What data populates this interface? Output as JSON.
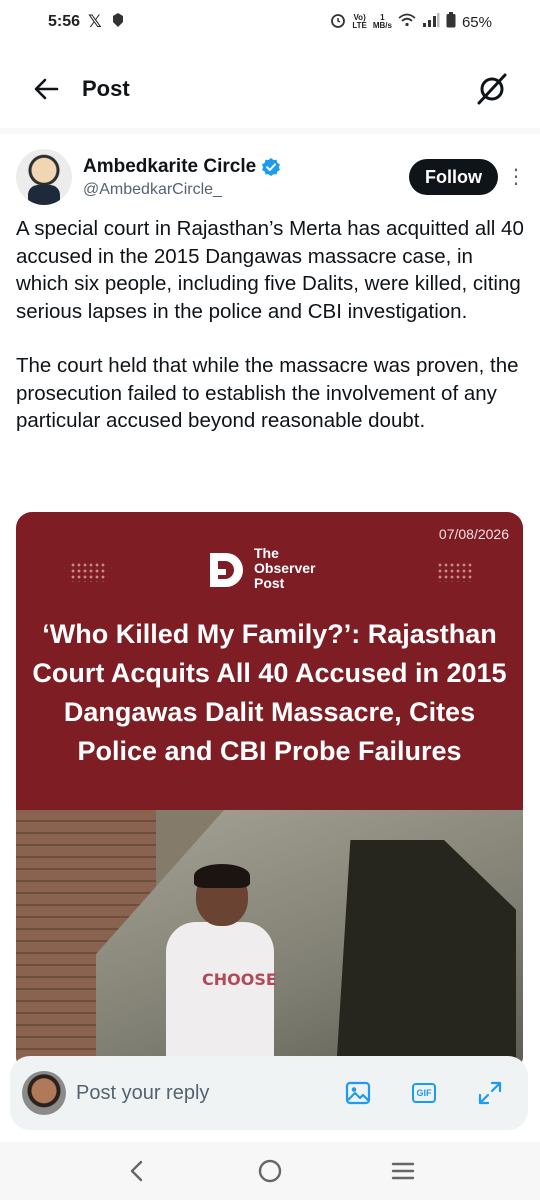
{
  "status_bar": {
    "time": "5:56",
    "net_top": "Vo)",
    "net_bottom": "LTE",
    "speed_top": "1",
    "speed_bottom": "MB/s",
    "battery": "65%"
  },
  "header": {
    "title": "Post"
  },
  "author": {
    "name": "Ambedkarite Circle",
    "handle": "@AmbedkarCircle_",
    "verified": true,
    "follow_label": "Follow",
    "more_glyph": "⋮"
  },
  "tweet": {
    "paragraph_1": "A special court in Rajasthan’s Merta has acquitted all 40 accused in the 2015 Dangawas massacre case, in which six people, including five Dalits, were killed, citing serious lapses in the police and CBI investigation.",
    "paragraph_2": "The court held that while the massacre was proven, the prosecution failed to establish the involvement of any particular accused beyond reasonable doubt."
  },
  "media": {
    "date": "07/08/2026",
    "logo_line_1": "The",
    "logo_line_2": "Observer",
    "logo_line_3": "Post",
    "headline": "‘Who Killed My Family?’: Rajasthan Court Acquits All 40 Accused in 2015 Dangawas Dalit Massacre, Cites Police and CBI Probe Failures",
    "shirt_text": "CHOOSE",
    "background_color": "#7e1e24"
  },
  "reply_bar": {
    "placeholder": "Post your reply",
    "gif_label": "GIF",
    "icons": [
      "image-icon",
      "gif-icon",
      "expand-icon"
    ]
  },
  "colors": {
    "accent": "#1d9bf0",
    "text": "#0f1419",
    "secondary_text": "#536471"
  }
}
